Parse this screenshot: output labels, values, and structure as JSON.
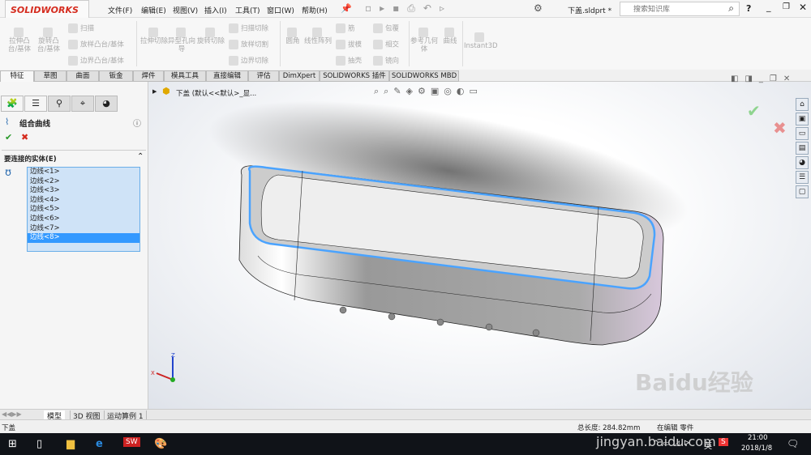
{
  "app": {
    "logo": "SOLIDWORKS",
    "doc_title": "下盖.sldprt *",
    "search_placeholder": "搜索知识库",
    "help": "?"
  },
  "menu": [
    "文件(F)",
    "编辑(E)",
    "视图(V)",
    "插入(I)",
    "工具(T)",
    "窗口(W)",
    "帮助(H)"
  ],
  "ribbon": {
    "big": [
      "拉伸凸台/基体",
      "旋转凸台/基体",
      "拉伸切除",
      "异型孔向导",
      "旋转切除",
      "圆角",
      "线性阵列",
      "参考几何体",
      "曲线",
      "Instant3D"
    ],
    "small": [
      "扫描",
      "放样凸台/基体",
      "边界凸台/基体",
      "扫描切除",
      "放样切割",
      "边界切除",
      "筋",
      "拔模",
      "抽壳",
      "包覆",
      "相交",
      "镜向"
    ]
  },
  "tabs": [
    "特征",
    "草图",
    "曲面",
    "钣金",
    "焊件",
    "模具工具",
    "直接编辑",
    "评估",
    "DimXpert",
    "SOLIDWORKS 插件",
    "SOLIDWORKS MBD"
  ],
  "panel": {
    "title": "组合曲线",
    "section": "要连接的实体(E)",
    "items": [
      "边线<1>",
      "边线<2>",
      "边线<3>",
      "边线<4>",
      "边线<5>",
      "边线<6>",
      "边线<7>",
      "边线<8>"
    ],
    "selected_index": 7
  },
  "tree": {
    "label": "下盖 (默认<<默认>_显..."
  },
  "bottom_tabs": [
    "模型",
    "3D 视图",
    "运动算例 1"
  ],
  "status": {
    "left": "下盖",
    "length": "总长度: 284.82mm",
    "mode": "在编辑 零件"
  },
  "taskbar": {
    "time": "21:00",
    "date": "2018/1/8",
    "ime": "英"
  },
  "watermark": {
    "text": "Baidu经验",
    "url": "jingyan.baidu.com"
  },
  "colors": {
    "brand": "#d52b1e",
    "select": "#3399ff",
    "edge": "#4aa3ff"
  }
}
